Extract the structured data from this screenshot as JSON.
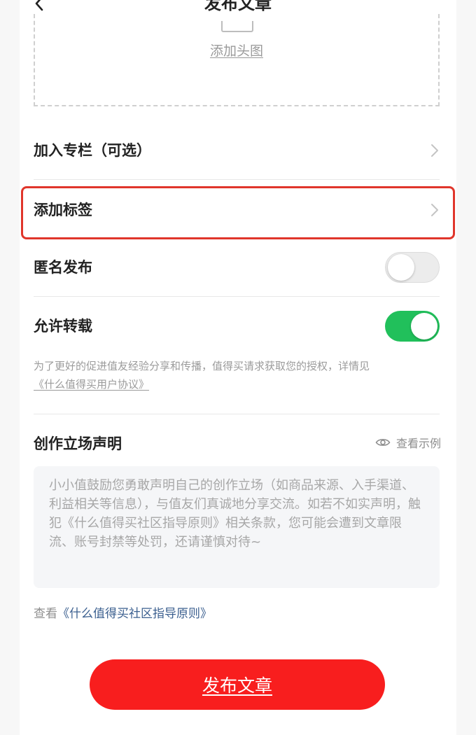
{
  "header": {
    "title": "发布文章",
    "back_icon": "chevron-left-icon"
  },
  "cover": {
    "label": "添加头图",
    "icon": "image-upload-icon"
  },
  "rows": {
    "column": {
      "label": "加入专栏（可选）"
    },
    "tags": {
      "label": "添加标签",
      "highlight_color": "#e0362b"
    },
    "anonymous": {
      "label": "匿名发布",
      "enabled": false
    },
    "repost": {
      "label": "允许转载",
      "enabled": true,
      "on_color": "#21c05b"
    }
  },
  "repost_note": {
    "text": "为了更好的促进值友经验分享和传播，值得买请求获取您的授权，详情见",
    "link": "《什么值得买用户协议》"
  },
  "statement": {
    "title": "创作立场声明",
    "example_label": "查看示例",
    "placeholder": "小小值鼓励您勇敢声明自己的创作立场（如商品来源、入手渠道、利益相关等信息），与值友们真诚地分享交流。如若不如实声明，触犯《什么值得买社区指导原则》相关条款，您可能会遭到文章限流、账号封禁等处罚，还请谨慎对待~"
  },
  "guide": {
    "prefix": "查看",
    "link": "《什么值得买社区指导原则》"
  },
  "publish": {
    "label": "发布文章",
    "color": "#f81e1e"
  }
}
